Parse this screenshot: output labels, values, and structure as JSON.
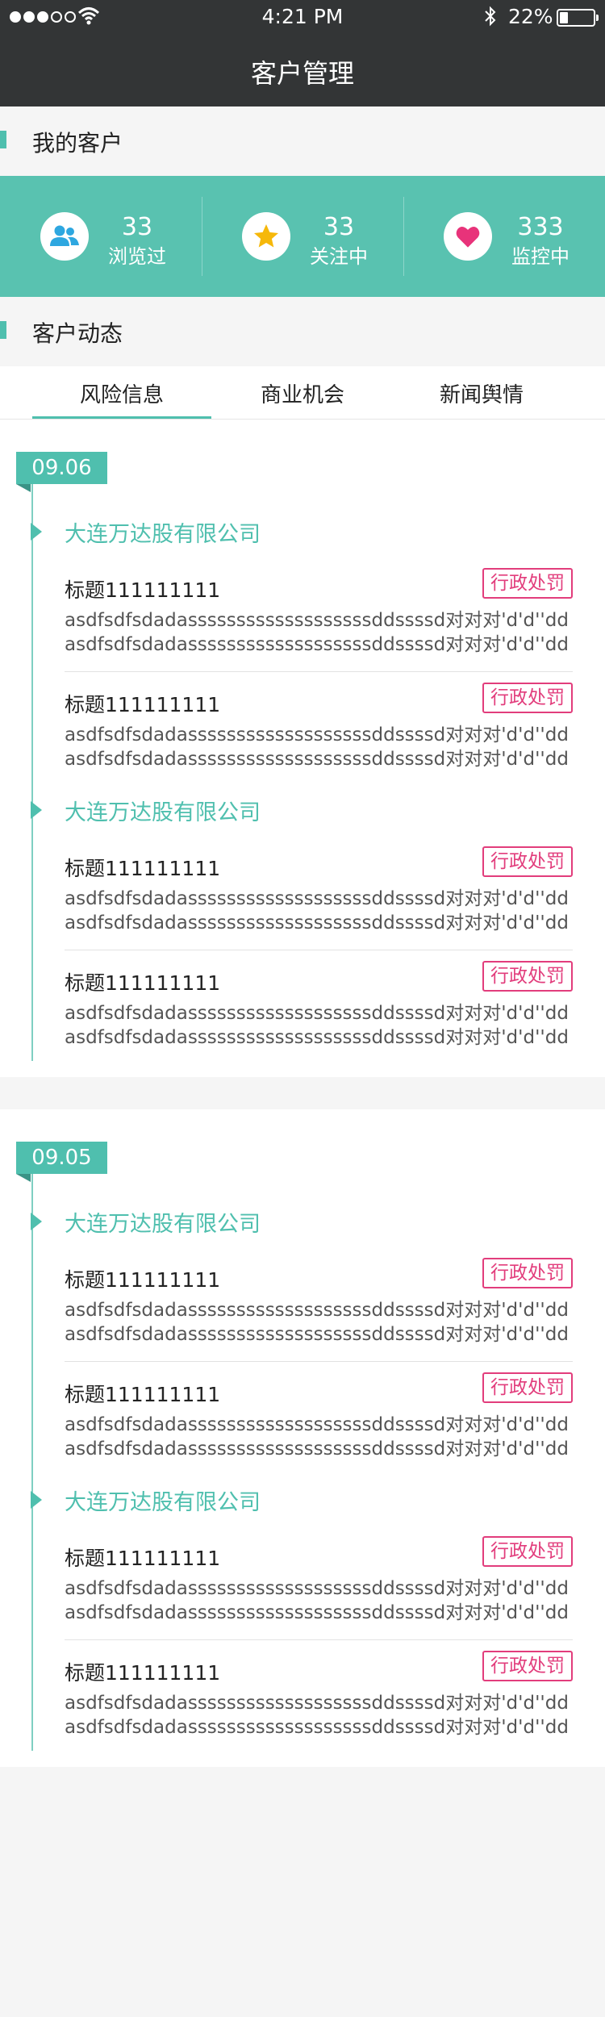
{
  "status_bar": {
    "time": "4:21 PM",
    "battery": "22%",
    "signal_bars": 3
  },
  "nav": {
    "title": "客户管理"
  },
  "my_customers": {
    "title": "我的客户",
    "stats": [
      {
        "icon": "users-icon",
        "count": "33",
        "label": "浏览过"
      },
      {
        "icon": "star-icon",
        "count": "33",
        "label": "关注中"
      },
      {
        "icon": "heart-icon",
        "count": "333",
        "label": "监控中"
      }
    ]
  },
  "dynamics": {
    "title": "客户动态",
    "tabs": [
      "风险信息",
      "商业机会",
      "新闻舆情"
    ],
    "active_tab": 0
  },
  "timeline": [
    {
      "date": "09.06",
      "groups": [
        {
          "company": "大连万达股有限公司",
          "items": [
            {
              "title": "标题111111111",
              "tag": "行政处罚",
              "desc": "asdfsdfsdadasssssssssssssssssssddssssd对对对'd'd''dd asdfsdfsdadasssssssssssssssssssddssssd对对对'd'd''dd"
            },
            {
              "title": "标题111111111",
              "tag": "行政处罚",
              "desc": "asdfsdfsdadasssssssssssssssssssddssssd对对对'd'd''dd asdfsdfsdadasssssssssssssssssssddssssd对对对'd'd''dd"
            }
          ]
        },
        {
          "company": "大连万达股有限公司",
          "items": [
            {
              "title": "标题111111111",
              "tag": "行政处罚",
              "desc": "asdfsdfsdadasssssssssssssssssssddssssd对对对'd'd''dd asdfsdfsdadasssssssssssssssssssddssssd对对对'd'd''dd"
            },
            {
              "title": "标题111111111",
              "tag": "行政处罚",
              "desc": "asdfsdfsdadasssssssssssssssssssddssssd对对对'd'd''dd asdfsdfsdadasssssssssssssssssssddssssd对对对'd'd''dd"
            }
          ]
        }
      ]
    },
    {
      "date": "09.05",
      "groups": [
        {
          "company": "大连万达股有限公司",
          "items": [
            {
              "title": "标题111111111",
              "tag": "行政处罚",
              "desc": "asdfsdfsdadasssssssssssssssssssddssssd对对对'd'd''dd asdfsdfsdadasssssssssssssssssssddssssd对对对'd'd''dd"
            },
            {
              "title": "标题111111111",
              "tag": "行政处罚",
              "desc": "asdfsdfsdadasssssssssssssssssssddssssd对对对'd'd''dd asdfsdfsdadasssssssssssssssssssddssssd对对对'd'd''dd"
            }
          ]
        },
        {
          "company": "大连万达股有限公司",
          "items": [
            {
              "title": "标题111111111",
              "tag": "行政处罚",
              "desc": "asdfsdfsdadasssssssssssssssssssddssssd对对对'd'd''dd asdfsdfsdadasssssssssssssssssssddssssd对对对'd'd''dd"
            },
            {
              "title": "标题111111111",
              "tag": "行政处罚",
              "desc": "asdfsdfsdadasssssssssssssssssssddssssd对对对'd'd''dd asdfsdfsdadasssssssssssssssssssddssssd对对对'd'd''dd"
            }
          ]
        }
      ]
    }
  ],
  "colors": {
    "accent": "#4fbfae",
    "band": "#59c2b0",
    "header": "#333536",
    "tag": "#e23d7c"
  }
}
